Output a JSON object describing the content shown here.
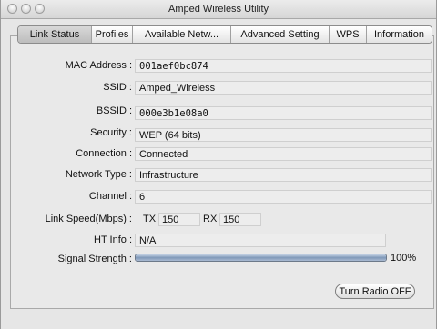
{
  "window": {
    "title": "Amped Wireless Utility"
  },
  "tabs": [
    {
      "label": "Link Status",
      "active": true
    },
    {
      "label": "Profiles"
    },
    {
      "label": "Available Netw..."
    },
    {
      "label": "Advanced Setting"
    },
    {
      "label": "WPS"
    },
    {
      "label": "Information"
    }
  ],
  "status": {
    "mac_label": "MAC Address :",
    "mac_value": "001aef0bc874",
    "ssid_label": "SSID :",
    "ssid_value": "Amped_Wireless",
    "bssid_label": "BSSID :",
    "bssid_value": "000e3b1e08a0",
    "security_label": "Security :",
    "security_value": "WEP (64 bits)",
    "connection_label": "Connection :",
    "connection_value": "Connected",
    "network_type_label": "Network Type :",
    "network_type_value": "Infrastructure",
    "channel_label": "Channel :",
    "channel_value": "6",
    "link_speed_label": "Link Speed(Mbps) :",
    "tx_label": "TX",
    "tx_value": "150",
    "rx_label": "RX",
    "rx_value": "150",
    "ht_info_label": "HT Info :",
    "ht_info_value": "N/A",
    "signal_label": "Signal Strength :",
    "signal_text": "100%",
    "signal_percent": 100
  },
  "buttons": {
    "turn_radio_off": "Turn Radio OFF"
  },
  "colors": {
    "bar_fill": "#7f98b8",
    "active_tab": "#c9c9c9"
  }
}
